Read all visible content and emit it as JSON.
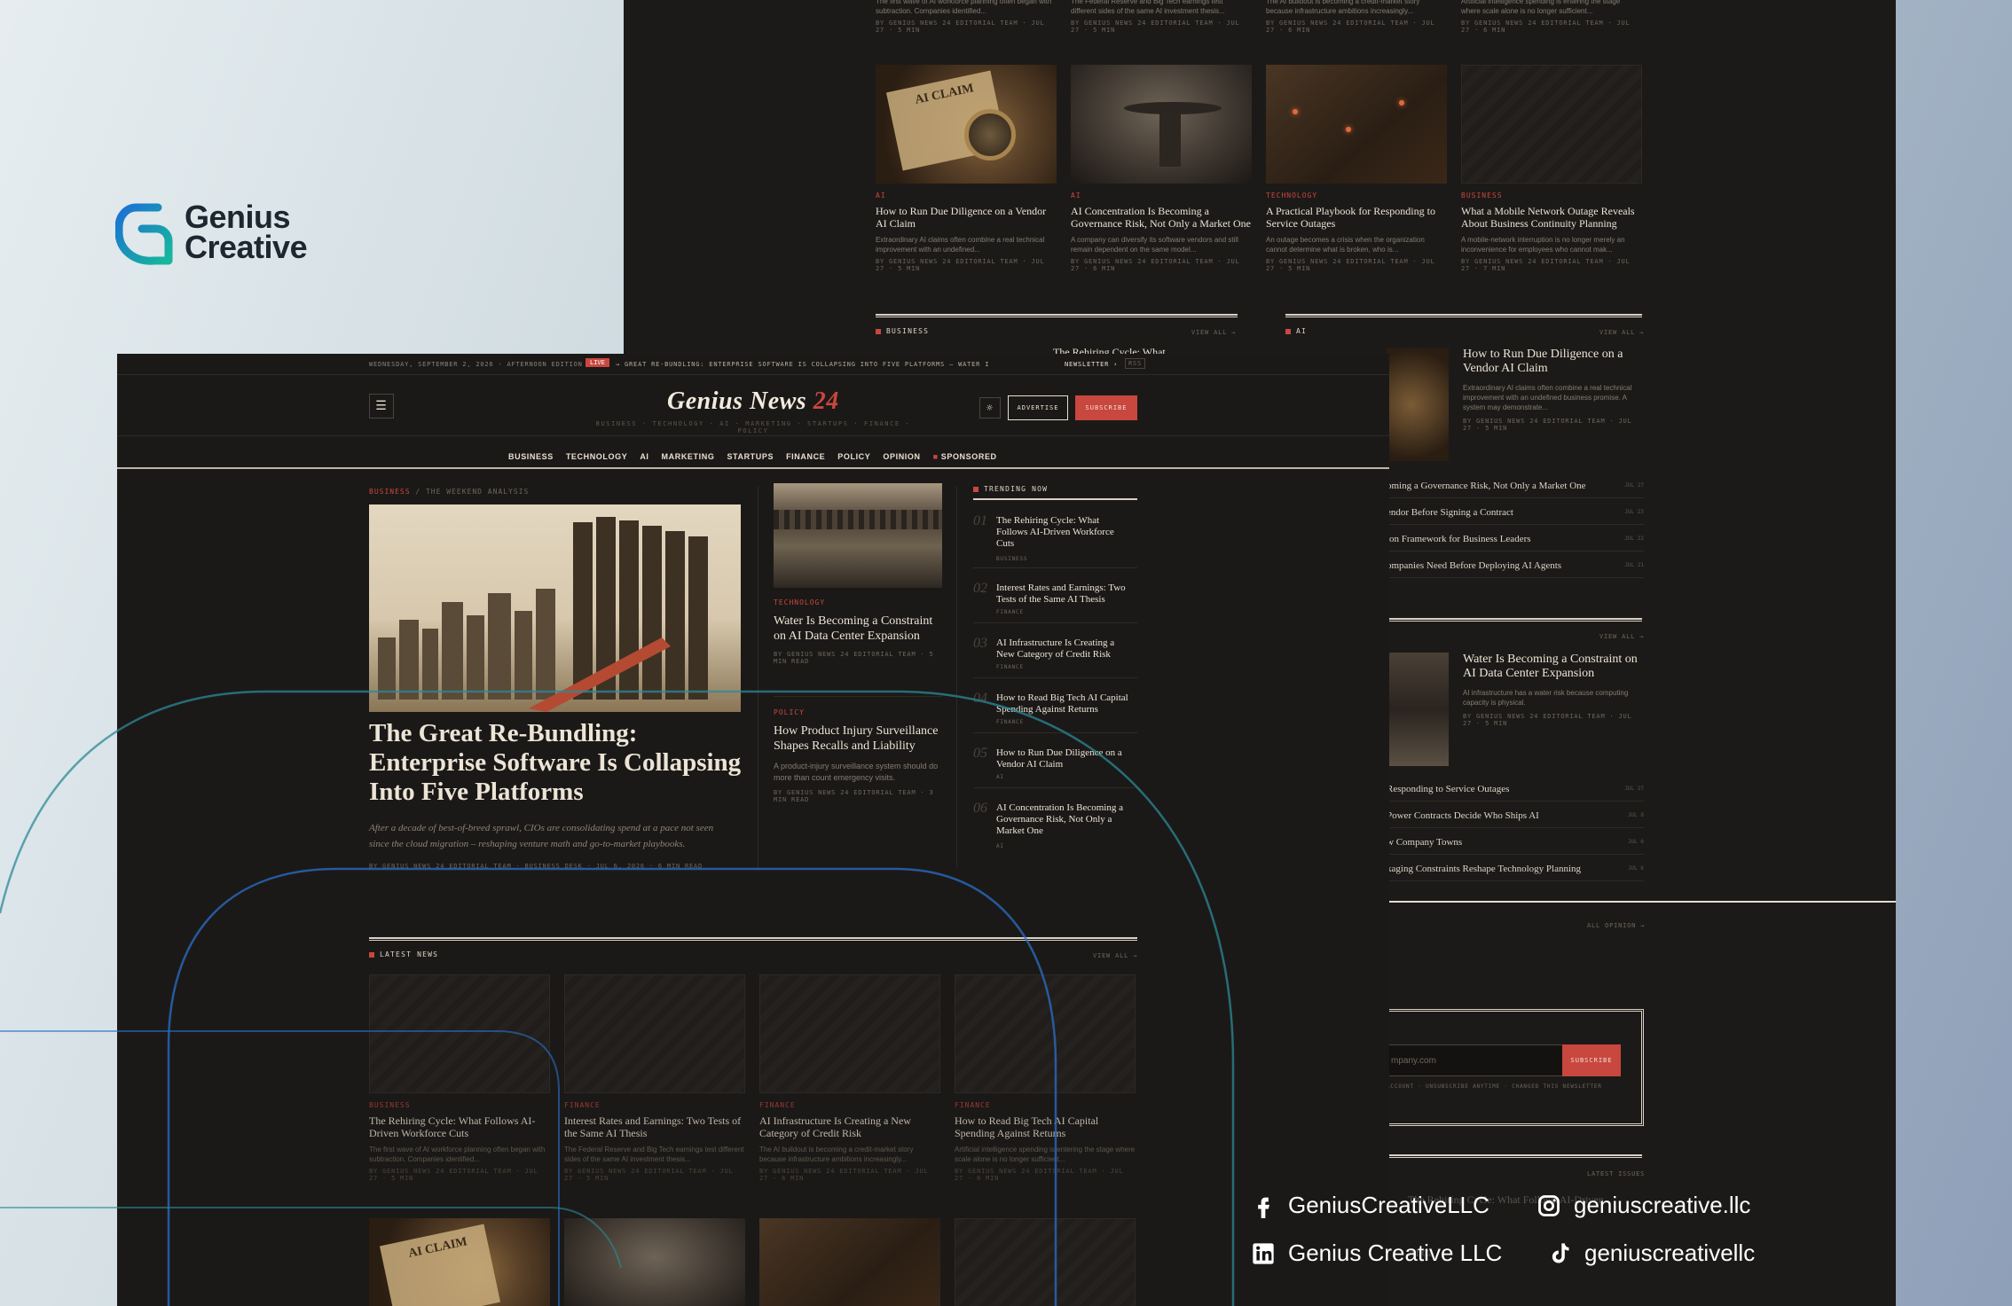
{
  "brand": {
    "line1": "Genius",
    "line2": "Creative"
  },
  "site": {
    "name": "Genius News",
    "name_num": "24",
    "date": "WEDNESDAY, SEPTEMBER 2, 2026 · AFTERNOON EDITION",
    "live": "LIVE",
    "ticker": "→ Great Re-Bundling: Enterprise Software Is Collapsing Into Five Platforms — Water Is Becoming a Constr",
    "newsletter": "NEWSLETTER ›",
    "rss": "RSS",
    "subnav": "BUSINESS · TECHNOLOGY · AI · MARKETING · STARTUPS · FINANCE · POLICY",
    "advertise": "ADVERTISE",
    "subscribe": "SUBSCRIBE",
    "nav": [
      "BUSINESS",
      "TECHNOLOGY",
      "AI",
      "MARKETING",
      "STARTUPS",
      "FINANCE",
      "POLICY",
      "OPINION",
      "SPONSORED"
    ]
  },
  "lead": {
    "kicker": "BUSINESS",
    "kicker2": "/ THE WEEKEND ANALYSIS",
    "title": "The Great Re-Bundling: Enterprise Software Is Collapsing Into Five Platforms",
    "dek": "After a decade of best-of-breed sprawl, CIOs are consolidating spend at a pace not seen since the cloud migration – reshaping venture math and go-to-market playbooks.",
    "meta": "BY GENIUS NEWS 24 EDITORIAL TEAM · BUSINESS DESK · JUL 6, 2026 · 6 MIN READ"
  },
  "mid": [
    {
      "kicker": "TECHNOLOGY",
      "title": "Water Is Becoming a Constraint on AI Data Center Expansion",
      "meta": "BY GENIUS NEWS 24 EDITORIAL TEAM · 5 MIN READ"
    },
    {
      "kicker": "POLICY",
      "title": "How Product Injury Surveillance Shapes Recalls and Liability",
      "excerpt": "A product-injury surveillance system should do more than count emergency visits.",
      "meta": "BY GENIUS NEWS 24 EDITORIAL TEAM · 3 MIN READ"
    }
  ],
  "trending": {
    "label": "TRENDING NOW",
    "items": [
      {
        "num": "01",
        "title": "The Rehiring Cycle: What Follows AI-Driven Workforce Cuts",
        "tag": "BUSINESS"
      },
      {
        "num": "02",
        "title": "Interest Rates and Earnings: Two Tests of the Same AI Thesis",
        "tag": "FINANCE"
      },
      {
        "num": "03",
        "title": "AI Infrastructure Is Creating a New Category of Credit Risk",
        "tag": "FINANCE"
      },
      {
        "num": "04",
        "title": "How to Read Big Tech AI Capital Spending Against Returns",
        "tag": "FINANCE"
      },
      {
        "num": "05",
        "title": "How to Run Due Diligence on a Vendor AI Claim",
        "tag": "AI"
      },
      {
        "num": "06",
        "title": "AI Concentration Is Becoming a Governance Risk, Not Only a Market One",
        "tag": "AI"
      }
    ]
  },
  "latest": {
    "label": "LATEST NEWS",
    "view_all": "VIEW ALL →",
    "cards": [
      {
        "kicker": "BUSINESS",
        "title": "The Rehiring Cycle: What Follows AI-Driven Workforce Cuts",
        "excerpt": "The first wave of AI workforce planning often began with subtraction. Companies identified...",
        "meta": "BY GENIUS NEWS 24 EDITORIAL TEAM · JUL 27 · 5 MIN"
      },
      {
        "kicker": "FINANCE",
        "title": "Interest Rates and Earnings: Two Tests of the Same AI Thesis",
        "excerpt": "The Federal Reserve and Big Tech earnings test different sides of the same AI investment thesis...",
        "meta": "BY GENIUS NEWS 24 EDITORIAL TEAM · JUL 27 · 5 MIN"
      },
      {
        "kicker": "FINANCE",
        "title": "AI Infrastructure Is Creating a New Category of Credit Risk",
        "excerpt": "The AI buildout is becoming a credit-market story because infrastructure ambitions increasingly...",
        "meta": "BY GENIUS NEWS 24 EDITORIAL TEAM · JUL 27 · 6 MIN"
      },
      {
        "kicker": "FINANCE",
        "title": "How to Read Big Tech AI Capital Spending Against Returns",
        "excerpt": "Artificial intelligence spending is entering the stage where scale alone is no longer sufficient...",
        "meta": "BY GENIUS NEWS 24 EDITORIAL TEAM · JUL 27 · 6 MIN"
      }
    ]
  },
  "back": {
    "top_excerpts": [
      {
        "excerpt": "The first wave of AI workforce planning often began with subtraction. Companies identified...",
        "meta": "BY GENIUS NEWS 24 EDITORIAL TEAM · JUL 27 · 5 MIN"
      },
      {
        "excerpt": "The Federal Reserve and Big Tech earnings test different sides of the same AI investment thesis...",
        "meta": "BY GENIUS NEWS 24 EDITORIAL TEAM · JUL 27 · 5 MIN"
      },
      {
        "excerpt": "The AI buildout is becoming a credit-market story because infrastructure ambitions increasingly...",
        "meta": "BY GENIUS NEWS 24 EDITORIAL TEAM · JUL 27 · 6 MIN"
      },
      {
        "excerpt": "Artificial intelligence spending is entering the stage where scale alone is no longer sufficient...",
        "meta": "BY GENIUS NEWS 24 EDITORIAL TEAM · JUL 27 · 6 MIN"
      }
    ],
    "cards": [
      {
        "kicker": "AI",
        "title": "How to Run Due Diligence on a Vendor AI Claim",
        "excerpt": "Extraordinary AI claims often combine a real technical improvement with an undefined...",
        "meta": "BY GENIUS NEWS 24 EDITORIAL TEAM · JUL 27 · 5 MIN"
      },
      {
        "kicker": "AI",
        "title": "AI Concentration Is Becoming a Governance Risk, Not Only a Market One",
        "excerpt": "A company can diversify its software vendors and still remain dependent on the same model...",
        "meta": "BY GENIUS NEWS 24 EDITORIAL TEAM · JUL 27 · 6 MIN"
      },
      {
        "kicker": "TECHNOLOGY",
        "title": "A Practical Playbook for Responding to Service Outages",
        "excerpt": "An outage becomes a crisis when the organization cannot determine what is broken, who is...",
        "meta": "BY GENIUS NEWS 24 EDITORIAL TEAM · JUL 27 · 5 MIN"
      },
      {
        "kicker": "BUSINESS",
        "title": "What a Mobile Network Outage Reveals About Business Continuity Planning",
        "excerpt": "A mobile-network interruption is no longer merely an inconvenience for employees who cannot mak...",
        "meta": "BY GENIUS NEWS 24 EDITORIAL TEAM · JUL 27 · 7 MIN"
      }
    ],
    "section_business": "BUSINESS",
    "section_ai": "AI",
    "view_all": "VIEW ALL →",
    "partial_title": "The Rehiring Cycle: What",
    "ai_feature": {
      "title": "How to Run Due Diligence on a Vendor AI Claim",
      "excerpt": "Extraordinary AI claims often combine a real technical improvement with an undefined business promise. A system may demonstrate...",
      "meta": "BY GENIUS NEWS 24 EDITORIAL TEAM · JUL 27 · 5 MIN"
    },
    "ai_list": [
      {
        "title": "oming a Governance Risk, Not Only a Market One",
        "date": "JUL 27"
      },
      {
        "title": "endor Before Signing a Contract",
        "date": "JUL 23"
      },
      {
        "title": "ion Framework for Business Leaders",
        "date": "JUL 22"
      },
      {
        "title": "ompanies Need Before Deploying AI Agents",
        "date": "JUL 21"
      }
    ],
    "tech_feature": {
      "title": "Water Is Becoming a Constraint on AI Data Center Expansion",
      "excerpt": "AI infrastructure has a water risk because computing capacity is physical.",
      "meta": "BY GENIUS NEWS 24 EDITORIAL TEAM · JUL 27 · 5 MIN"
    },
    "tech_list": [
      {
        "title": "Responding to Service Outages",
        "date": "JUL 27"
      },
      {
        "title": "Power Contracts Decide Who Ships AI",
        "date": "JUL 8"
      },
      {
        "title": "w Company Towns",
        "date": "JUL 6"
      },
      {
        "title": "kaging Constraints Reshape Technology Planning",
        "date": "JUL 6"
      }
    ],
    "all_opinion": "ALL OPINION →",
    "email_placeholder": "mpany.com",
    "subscribe": "SUBSCRIBE",
    "fine_print": "ACCOUNT · UNSUBSCRIBE ANYTIME · CHANGED THIS NEWSLETTER",
    "latest_label": "LATEST ISSUES",
    "bottom_partial": "The Rehiring Cycle: What Follows AI-Driven",
    "bottom_partial2": "AI Ca"
  },
  "socials": [
    {
      "icon": "facebook-icon",
      "label": "GeniusCreativeLLC"
    },
    {
      "icon": "instagram-icon",
      "label": "geniuscreative.llc"
    },
    {
      "icon": "linkedin-icon",
      "label": "Genius Creative LLC"
    },
    {
      "icon": "tiktok-icon",
      "label": "geniuscreativellc"
    }
  ],
  "colors": {
    "accent": "#c8473e",
    "bg": "#1b1917",
    "brand_blue": "#1c6fd6",
    "brand_teal": "#17b89a"
  }
}
